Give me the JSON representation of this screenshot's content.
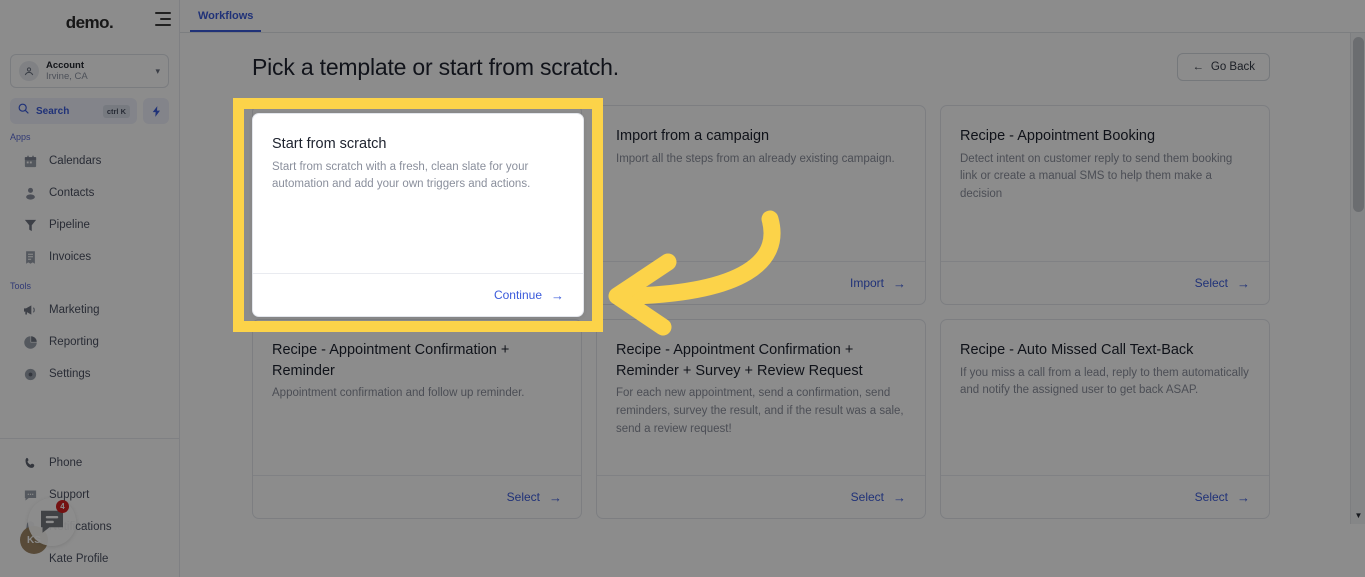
{
  "sidebar": {
    "logo": "demo.",
    "hamburger_icon": "hamburger-menu-icon",
    "account": {
      "name": "Account",
      "location": "Irvine, CA",
      "avatar_icon": "user-circle-icon",
      "caret_icon": "chevron-down-icon"
    },
    "search": {
      "label": "Search",
      "shortcut": "ctrl K",
      "icon": "search-icon"
    },
    "bolt": {
      "icon": "lightning-bolt-icon"
    },
    "sections": [
      {
        "label": "Apps",
        "items": [
          {
            "label": "Calendars",
            "icon": "calendar-icon"
          },
          {
            "label": "Contacts",
            "icon": "contacts-icon"
          },
          {
            "label": "Pipeline",
            "icon": "pipeline-funnel-icon"
          },
          {
            "label": "Invoices",
            "icon": "invoice-icon"
          }
        ]
      },
      {
        "label": "Tools",
        "items": [
          {
            "label": "Marketing",
            "icon": "megaphone-icon"
          },
          {
            "label": "Reporting",
            "icon": "pie-chart-icon"
          },
          {
            "label": "Settings",
            "icon": "gear-icon"
          }
        ]
      }
    ],
    "bottom_items": [
      {
        "label": "Phone",
        "icon": "phone-icon"
      },
      {
        "label": "Support",
        "icon": "support-chat-icon"
      },
      {
        "label": "Notifications",
        "icon": "bell-icon"
      },
      {
        "label": "Kate Profile",
        "icon": "avatar-icon"
      }
    ],
    "notification_badge": "4",
    "profile_initials": "KS",
    "chat_widget_icon": "chat-bubble-icon"
  },
  "main": {
    "tabs": [
      {
        "label": "Workflows",
        "active": true
      }
    ],
    "page_title": "Pick a template or start from scratch.",
    "go_back": {
      "label": "Go Back",
      "icon": "arrow-left-icon"
    },
    "cards": [
      {
        "title": "Start from scratch",
        "desc": "Start from scratch with a fresh, clean slate for your automation and add your own triggers and actions.",
        "action": "Continue",
        "action_icon": "arrow-right-icon",
        "highlighted": true
      },
      {
        "title": "Import from a campaign",
        "desc": "Import all the steps from an already existing campaign.",
        "action": "Import",
        "action_icon": "arrow-right-icon",
        "highlighted": false
      },
      {
        "title": "Recipe - Appointment Booking",
        "desc": "Detect intent on customer reply to send them booking link or create a manual SMS to help them make a decision",
        "action": "Select",
        "action_icon": "arrow-right-icon",
        "highlighted": false
      },
      {
        "title": "Recipe - Appointment Confirmation + Reminder",
        "desc": "Appointment confirmation and follow up reminder.",
        "action": "Select",
        "action_icon": "arrow-right-icon",
        "highlighted": false
      },
      {
        "title": "Recipe - Appointment Confirmation + Reminder + Survey + Review Request",
        "desc": "For each new appointment, send a confirmation, send reminders, survey the result, and if the result was a sale, send a review request!",
        "action": "Select",
        "action_icon": "arrow-right-icon",
        "highlighted": false
      },
      {
        "title": "Recipe - Auto Missed Call Text-Back",
        "desc": "If you miss a call from a lead, reply to them automatically and notify the assigned user to get back ASAP.",
        "action": "Select",
        "action_icon": "arrow-right-icon",
        "highlighted": false
      }
    ]
  },
  "annotation": {
    "highlight_color": "#fcd349",
    "arrow_icon": "curved-arrow-pointing-left"
  },
  "colors": {
    "accent_blue": "#3b5bdb",
    "highlight_yellow": "#fcd349",
    "badge_red": "#d32020"
  }
}
